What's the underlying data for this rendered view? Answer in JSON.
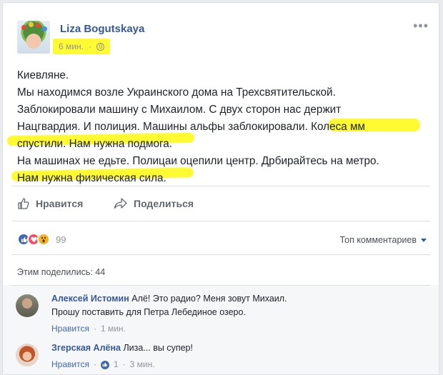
{
  "post": {
    "author": "Liza Bogutskaya",
    "time": "6 мин.",
    "privacy_icon": "globe-icon",
    "more_menu": "•••",
    "paragraphs": [
      "Киевляне.",
      "Мы находимся возле Украинского дома на Трехсвятительской.",
      "Заблокировали машину с Михаилом. С двух сторон нас держит",
      "Нацгвардия. И полиция. Машины альфы заблокировали. Колеса мм",
      "спустили. Нам нужна подмога.",
      "На машинах не едьте. Полицаи оцепили центр. Дрбирайтесь на метро.",
      "Нам нужна физическая сила."
    ],
    "highlight_color": "#fffa32"
  },
  "actions": {
    "like_label": "Нравится",
    "share_label": "Поделиться"
  },
  "stats": {
    "reactions_count": "99",
    "reaction_types": [
      "like",
      "love",
      "wow"
    ],
    "sort_label": "Топ комментариев",
    "shares_text": "Этим поделились: 44"
  },
  "comments": [
    {
      "name": "Алексей Истомин",
      "text_line1": "Алё! Это радио? Меня зовут Михаил.",
      "text_line2": "Прошу поставить для Петра Лебединое озеро.",
      "like_label": "Нравится",
      "sep": "·",
      "time": "1 мин."
    },
    {
      "name": "Згерская Алёна",
      "text": "Лиза... вы супер!",
      "like_label": "Нравится",
      "sep": "·",
      "likes": "1",
      "sep2": "·",
      "time": "3 мин."
    }
  ],
  "colors": {
    "link_blue": "#365899",
    "like_blue": "#4267b2",
    "love_red": "#f25268",
    "wow_yellow": "#f7b125"
  }
}
